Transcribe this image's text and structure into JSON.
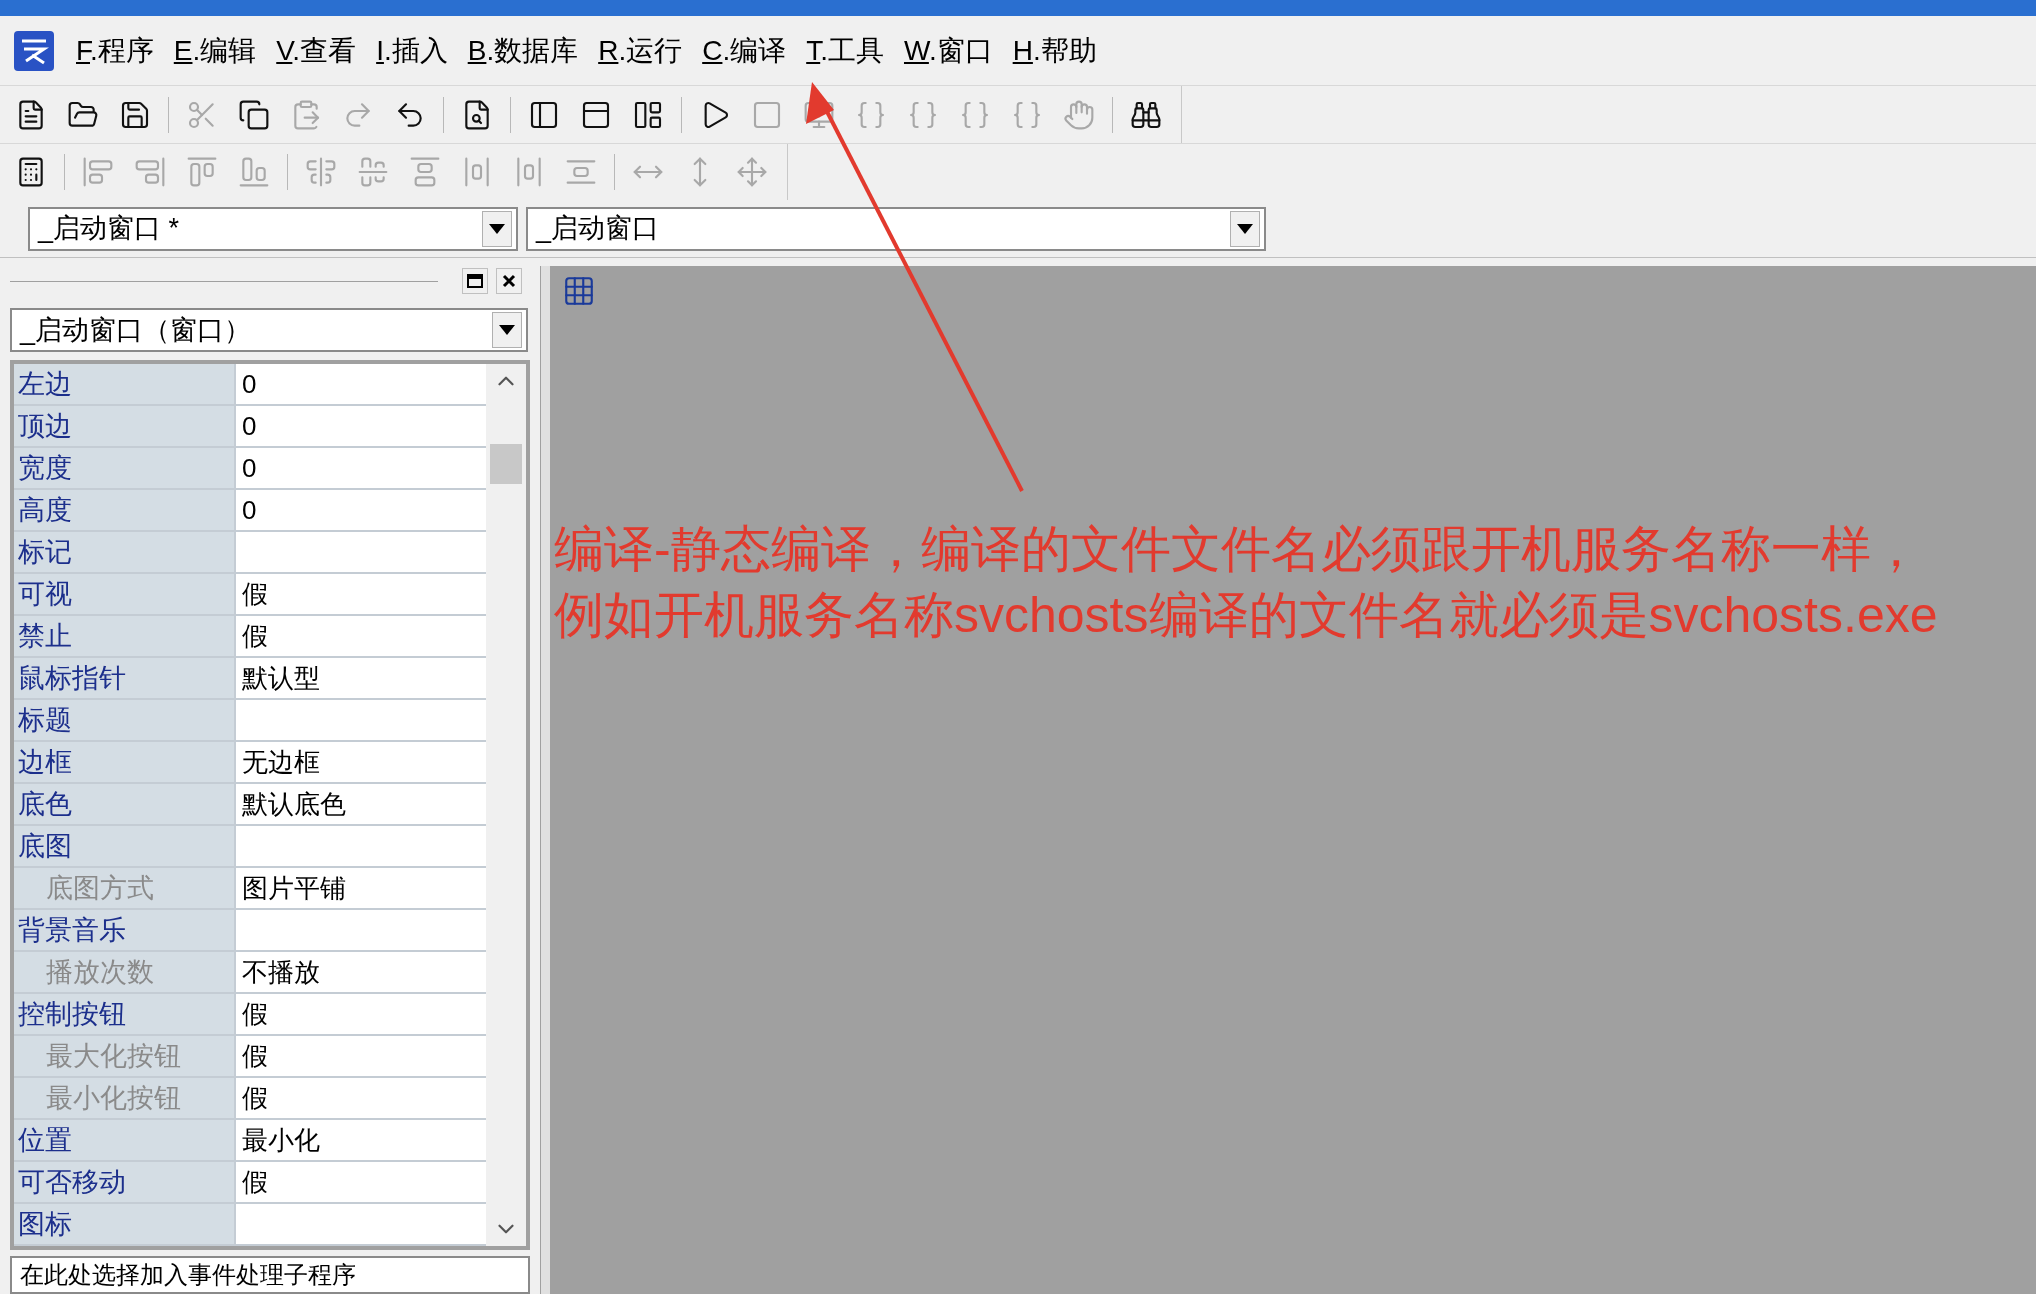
{
  "menu": [
    {
      "key": "F",
      "label": ".程序"
    },
    {
      "key": "E",
      "label": ".编辑"
    },
    {
      "key": "V",
      "label": ".查看"
    },
    {
      "key": "I",
      "label": ".插入"
    },
    {
      "key": "B",
      "label": ".数据库"
    },
    {
      "key": "R",
      "label": ".运行"
    },
    {
      "key": "C",
      "label": ".编译"
    },
    {
      "key": "T",
      "label": ".工具"
    },
    {
      "key": "W",
      "label": ".窗口"
    },
    {
      "key": "H",
      "label": ".帮助"
    }
  ],
  "toolbar_1": [
    {
      "disabled": false
    },
    {
      "disabled": false
    },
    {
      "disabled": false
    },
    {
      "disabled": true
    },
    {
      "disabled": false
    },
    {
      "disabled": true
    },
    {
      "disabled": true
    },
    {
      "disabled": false
    },
    {
      "disabled": false
    },
    {
      "disabled": false
    },
    {
      "disabled": false
    },
    {
      "disabled": false
    },
    {
      "disabled": false
    },
    {
      "disabled": true
    },
    {
      "disabled": true
    },
    {
      "disabled": true
    },
    {
      "disabled": true
    },
    {
      "disabled": true
    },
    {
      "disabled": true
    },
    {
      "disabled": true
    },
    {
      "disabled": false
    }
  ],
  "toolbar_2": [
    {
      "disabled": false
    },
    {
      "disabled": true
    },
    {
      "disabled": true
    },
    {
      "disabled": true
    },
    {
      "disabled": true
    },
    {
      "disabled": true
    },
    {
      "disabled": true
    },
    {
      "disabled": true
    },
    {
      "disabled": true
    },
    {
      "disabled": true
    },
    {
      "disabled": true
    },
    {
      "disabled": true
    },
    {
      "disabled": true
    },
    {
      "disabled": true
    }
  ],
  "object_selector": {
    "value": "_启动窗口 *"
  },
  "method_selector": {
    "value": "_启动窗口"
  },
  "properties_panel": {
    "object": "_启动窗口（窗口）",
    "rows": [
      {
        "kind": "property",
        "name": "左边",
        "value": "0"
      },
      {
        "kind": "property",
        "name": "顶边",
        "value": "0"
      },
      {
        "kind": "property",
        "name": "宽度",
        "value": "0"
      },
      {
        "kind": "property",
        "name": "高度",
        "value": "0"
      },
      {
        "kind": "property",
        "name": "标记"
      },
      {
        "kind": "property",
        "name": "可视",
        "value": "假"
      },
      {
        "kind": "property",
        "name": "禁止",
        "value": "假"
      },
      {
        "kind": "property",
        "name": "鼠标指针",
        "value": "默认型"
      },
      {
        "kind": "property",
        "name": "标题"
      },
      {
        "kind": "property",
        "name": "边框",
        "value": "无边框"
      },
      {
        "kind": "property",
        "name": "底色",
        "value": "默认底色"
      },
      {
        "kind": "property",
        "name": "底图"
      },
      {
        "kind": "sub",
        "name": "底图方式",
        "value": "图片平铺"
      },
      {
        "kind": "property",
        "name": "背景音乐"
      },
      {
        "kind": "sub",
        "name": "播放次数",
        "value": "不播放"
      },
      {
        "kind": "property",
        "name": "控制按钮",
        "value": "假"
      },
      {
        "kind": "sub",
        "name": "最大化按钮",
        "value": "假"
      },
      {
        "kind": "sub",
        "name": "最小化按钮",
        "value": "假"
      },
      {
        "kind": "property",
        "name": "位置",
        "value": "最小化"
      },
      {
        "kind": "property",
        "name": "可否移动",
        "value": "假"
      },
      {
        "kind": "property",
        "name": "图标"
      }
    ],
    "event_selector": {
      "value": "在此处选择加入事件处理子程序"
    }
  },
  "annotation": {
    "lines": [
      "编译-静态编译，编译的文件文件名必须跟开机服务名称一样，",
      "例如开机服务名称svchosts编译的文件名就必须是svchosts.exe"
    ]
  }
}
